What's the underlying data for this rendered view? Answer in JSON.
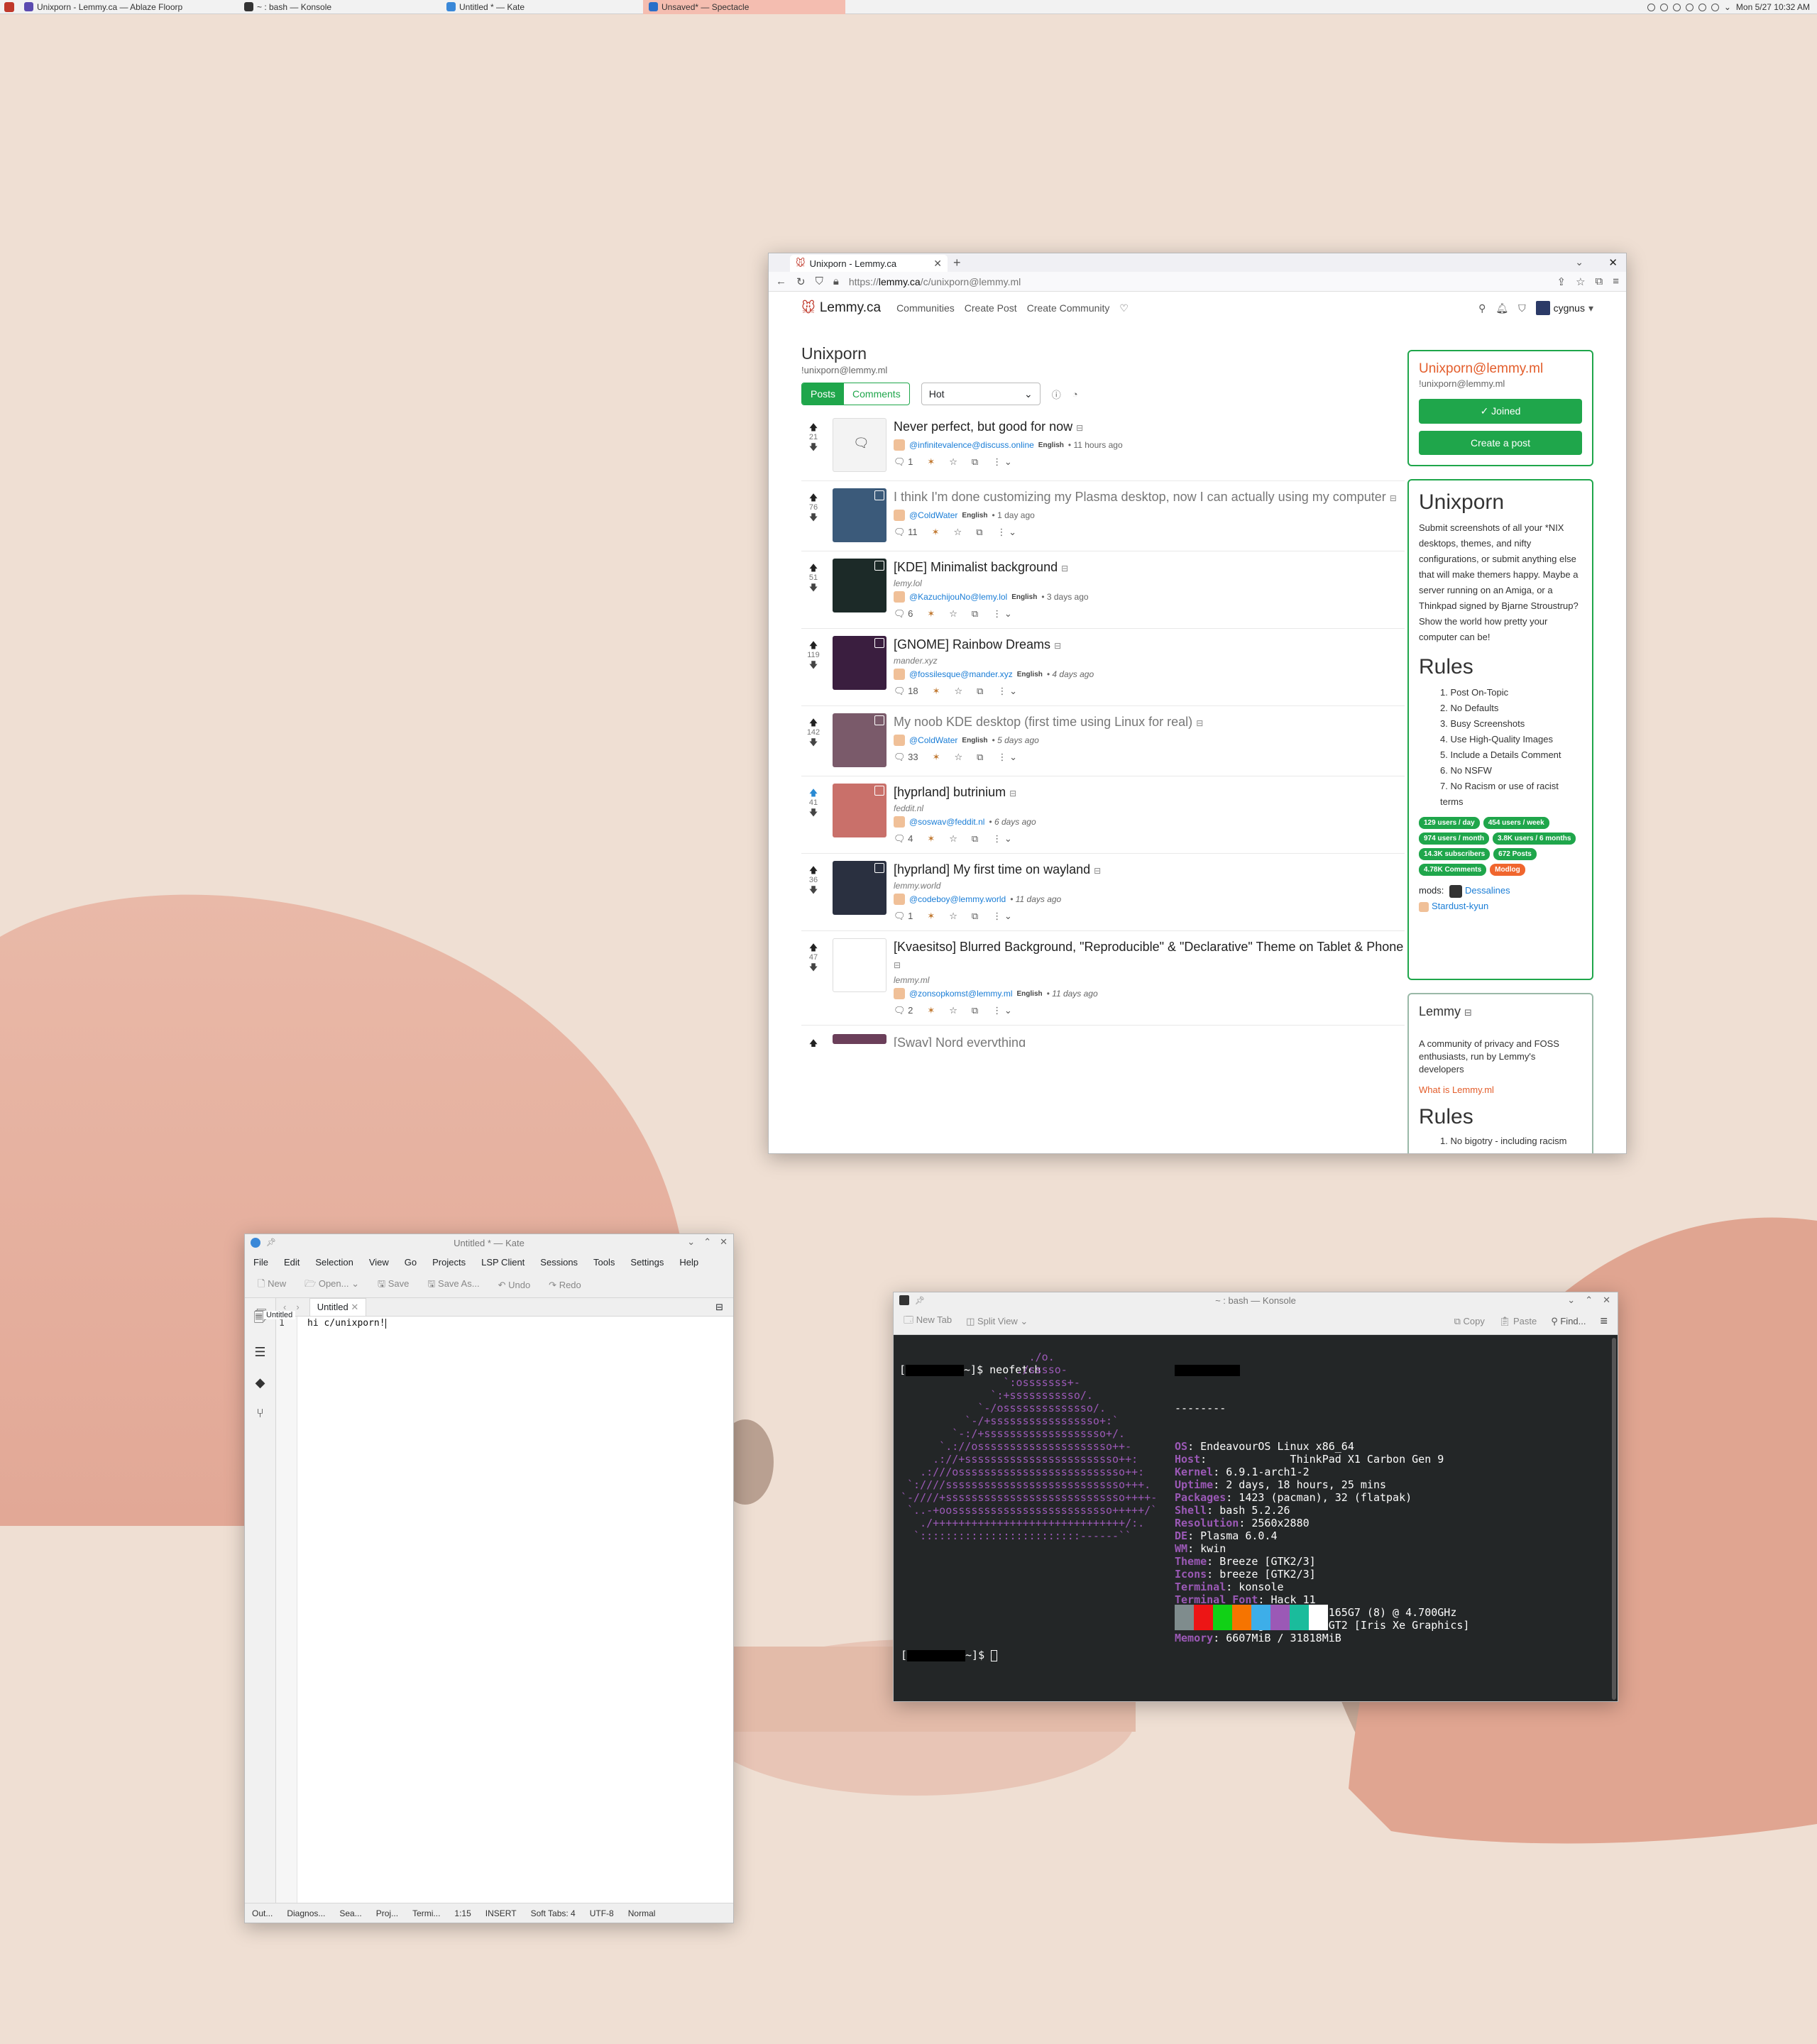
{
  "taskbar": {
    "tasks": [
      {
        "title": "Unixporn - Lemmy.ca — Ablaze Floorp",
        "color": "#5b4bb0"
      },
      {
        "title": "~ : bash — Konsole",
        "color": "#333"
      },
      {
        "title": "Untitled * — Kate",
        "color": "#3a88d8"
      },
      {
        "title": "Unsaved* — Spectacle",
        "color": "#2a6fc9"
      }
    ],
    "clock": "Mon 5/27 10:32 AM"
  },
  "browser": {
    "tab_title": "Unixporn - Lemmy.ca",
    "url_prefix": "https://",
    "url_host": "lemmy.ca",
    "url_path": "/c/unixporn@lemmy.ml",
    "site": {
      "logo": "Lemmy.ca",
      "nav": [
        "Communities",
        "Create Post",
        "Create Community"
      ],
      "user": "cygnus"
    },
    "community": {
      "title": "Unixporn",
      "handle": "!unixporn@lemmy.ml",
      "tab_posts": "Posts",
      "tab_comments": "Comments",
      "sort": "Hot"
    },
    "posts": [
      {
        "score": "21",
        "title": "Never perfect, but good for now",
        "user": "@infinitevalence@discuss.online",
        "lang": "English",
        "time": "• 11 hours ago",
        "comments": "1",
        "domain": "",
        "thumb": "#f3f3f3",
        "muted": false,
        "up": false
      },
      {
        "score": "76",
        "title": "I think I'm done customizing my Plasma desktop, now I can actually using my computer",
        "user": "@ColdWater",
        "lang": "English",
        "time": "• 1 day ago",
        "comments": "11",
        "domain": "",
        "thumb": "#3b5a7a",
        "muted": true,
        "up": false
      },
      {
        "score": "51",
        "title": "[KDE] Minimalist background",
        "user": "@KazuchijouNo@lemy.lol",
        "lang": "English",
        "time": "• 3 days ago",
        "comments": "6",
        "domain": "lemy.lol",
        "thumb": "#1c2a28",
        "muted": false,
        "up": false
      },
      {
        "score": "119",
        "title": "[GNOME] Rainbow Dreams",
        "user": "@fossilesque@mander.xyz",
        "lang": "English",
        "time": "• 4 days ago",
        "comments": "18",
        "domain": "mander.xyz",
        "thumb": "#3a1e3f",
        "muted": false,
        "up": false
      },
      {
        "score": "142",
        "title": "My noob KDE desktop (first time using Linux for real)",
        "user": "@ColdWater",
        "lang": "English",
        "time": "• 5 days ago",
        "comments": "33",
        "domain": "",
        "thumb": "#7a5a6a",
        "muted": true,
        "up": false
      },
      {
        "score": "41",
        "title": "[hyprland] butrinium",
        "user": "@soswav@feddit.nl",
        "lang": "",
        "time": "• 6 days ago",
        "comments": "4",
        "domain": "feddit.nl",
        "thumb": "#c9706a",
        "muted": false,
        "up": true
      },
      {
        "score": "36",
        "title": "[hyprland] My first time on wayland",
        "user": "@codeboy@lemmy.world",
        "lang": "",
        "time": "• 11 days ago",
        "comments": "1",
        "domain": "lemmy.world",
        "thumb": "#2a3040",
        "muted": false,
        "up": false
      },
      {
        "score": "47",
        "title": "[Kvaesitso] Blurred Background, \"Reproducible\" & \"Declarative\" Theme on Tablet & Phone",
        "user": "@zonsopkomst@lemmy.ml",
        "lang": "English",
        "time": "• 11 days ago",
        "comments": "2",
        "domain": "lemmy.ml",
        "thumb": "#ffffff",
        "muted": false,
        "up": false
      }
    ],
    "next_post": "[Sway] Nord everything",
    "sidebar": {
      "name": "Unixporn@lemmy.ml",
      "handle": "!unixporn@lemmy.ml",
      "joined": "✓ Joined",
      "create": "Create a post",
      "about_title": "Unixporn",
      "about": "Submit screenshots of all your *NIX desktops, themes, and nifty configurations, or submit anything else that will make themers happy. Maybe a server running on an Amiga, or a Thinkpad signed by Bjarne Stroustrup? Show the world how pretty your computer can be!",
      "rules_title": "Rules",
      "rules": [
        "1. Post On-Topic",
        "2. No Defaults",
        "3. Busy Screenshots",
        "4. Use High-Quality Images",
        "5. Include a Details Comment",
        "6. No NSFW",
        "7. No Racism or use of racist terms"
      ],
      "badges": [
        "129 users / day",
        "454 users / week",
        "974 users / month",
        "3.8K users / 6 months",
        "14.3K subscribers",
        "672 Posts",
        "4.78K Comments"
      ],
      "modlog": "Modlog",
      "mods_label": "mods:",
      "mods": [
        "Dessalines",
        "Stardust-kyun"
      ],
      "inst_title": "Lemmy",
      "inst_desc": "A community of privacy and FOSS enthusiasts, run by Lemmy's developers",
      "inst_link": "What is Lemmy.ml",
      "inst_rules": "Rules",
      "inst_rule1": "1. No bigotry - including racism"
    }
  },
  "kate": {
    "title": "Untitled * — Kate",
    "menu": [
      "File",
      "Edit",
      "Selection",
      "View",
      "Go",
      "Projects",
      "LSP Client",
      "Sessions",
      "Tools",
      "Settings",
      "Help"
    ],
    "tools": [
      "New",
      "Open...",
      "Save",
      "Save As...",
      "Undo",
      "Redo"
    ],
    "tab": "Untitled",
    "breadcrumb": "Untitled",
    "line_no": "1",
    "line": "hi c/unixporn!",
    "status": [
      "Out...",
      "Diagnos...",
      "Sea...",
      "Proj...",
      "Termi...",
      "1:15",
      "INSERT",
      "Soft Tabs: 4",
      "UTF-8",
      "Normal"
    ]
  },
  "konsole": {
    "title": "~ : bash — Konsole",
    "tools": [
      "New Tab",
      "Split View"
    ],
    "tools_right": [
      "Copy",
      "Paste",
      "Find..."
    ],
    "cmd": "~]$ neofetch",
    "prompt": "~]$",
    "art": "                    ./o.\n                  ./sssso-\n                `:osssssss+-\n              `:+sssssssssso/.\n            `-/ossssssssssssso/.\n          `-/+sssssssssssssssso+:`\n        `-:/+sssssssssssssssssso+/.\n      `.://osssssssssssssssssssso++-\n     .://+ssssssssssssssssssssssso++:\n   .:///ossssssssssssssssssssssssso++:\n `:////ssssssssssssssssssssssssssso+++.\n`-////+ssssssssssssssssssssssssssso++++-\n `..-+oosssssssssssssssssssssssso+++++/`\n   ./++++++++++++++++++++++++++++++/:.\n  `:::::::::::::::::::::::::------``",
    "sep": "--------",
    "info": [
      {
        "k": "OS",
        "v": ": EndeavourOS Linux x86_64"
      },
      {
        "k": "Host",
        "v": ":             ThinkPad X1 Carbon Gen 9"
      },
      {
        "k": "Kernel",
        "v": ": 6.9.1-arch1-2"
      },
      {
        "k": "Uptime",
        "v": ": 2 days, 18 hours, 25 mins"
      },
      {
        "k": "Packages",
        "v": ": 1423 (pacman), 32 (flatpak)"
      },
      {
        "k": "Shell",
        "v": ": bash 5.2.26"
      },
      {
        "k": "Resolution",
        "v": ": 2560x2880"
      },
      {
        "k": "DE",
        "v": ": Plasma 6.0.4"
      },
      {
        "k": "WM",
        "v": ": kwin"
      },
      {
        "k": "Theme",
        "v": ": Breeze [GTK2/3]"
      },
      {
        "k": "Icons",
        "v": ": breeze [GTK2/3]"
      },
      {
        "k": "Terminal",
        "v": ": konsole"
      },
      {
        "k": "Terminal Font",
        "v": ": Hack 11"
      },
      {
        "k": "CPU",
        "v": ": 11th Gen Intel i7-1165G7 (8) @ 4.700GHz"
      },
      {
        "k": "GPU",
        "v": ": Intel TigerLake-LP GT2 [Iris Xe Graphics]"
      },
      {
        "k": "Memory",
        "v": ": 6607MiB / 31818MiB"
      }
    ],
    "swatches": [
      "#7f8c8d",
      "#ed1515",
      "#11d116",
      "#f67400",
      "#3daee9",
      "#9b59b6",
      "#1abc9c",
      "#ffffff"
    ]
  }
}
